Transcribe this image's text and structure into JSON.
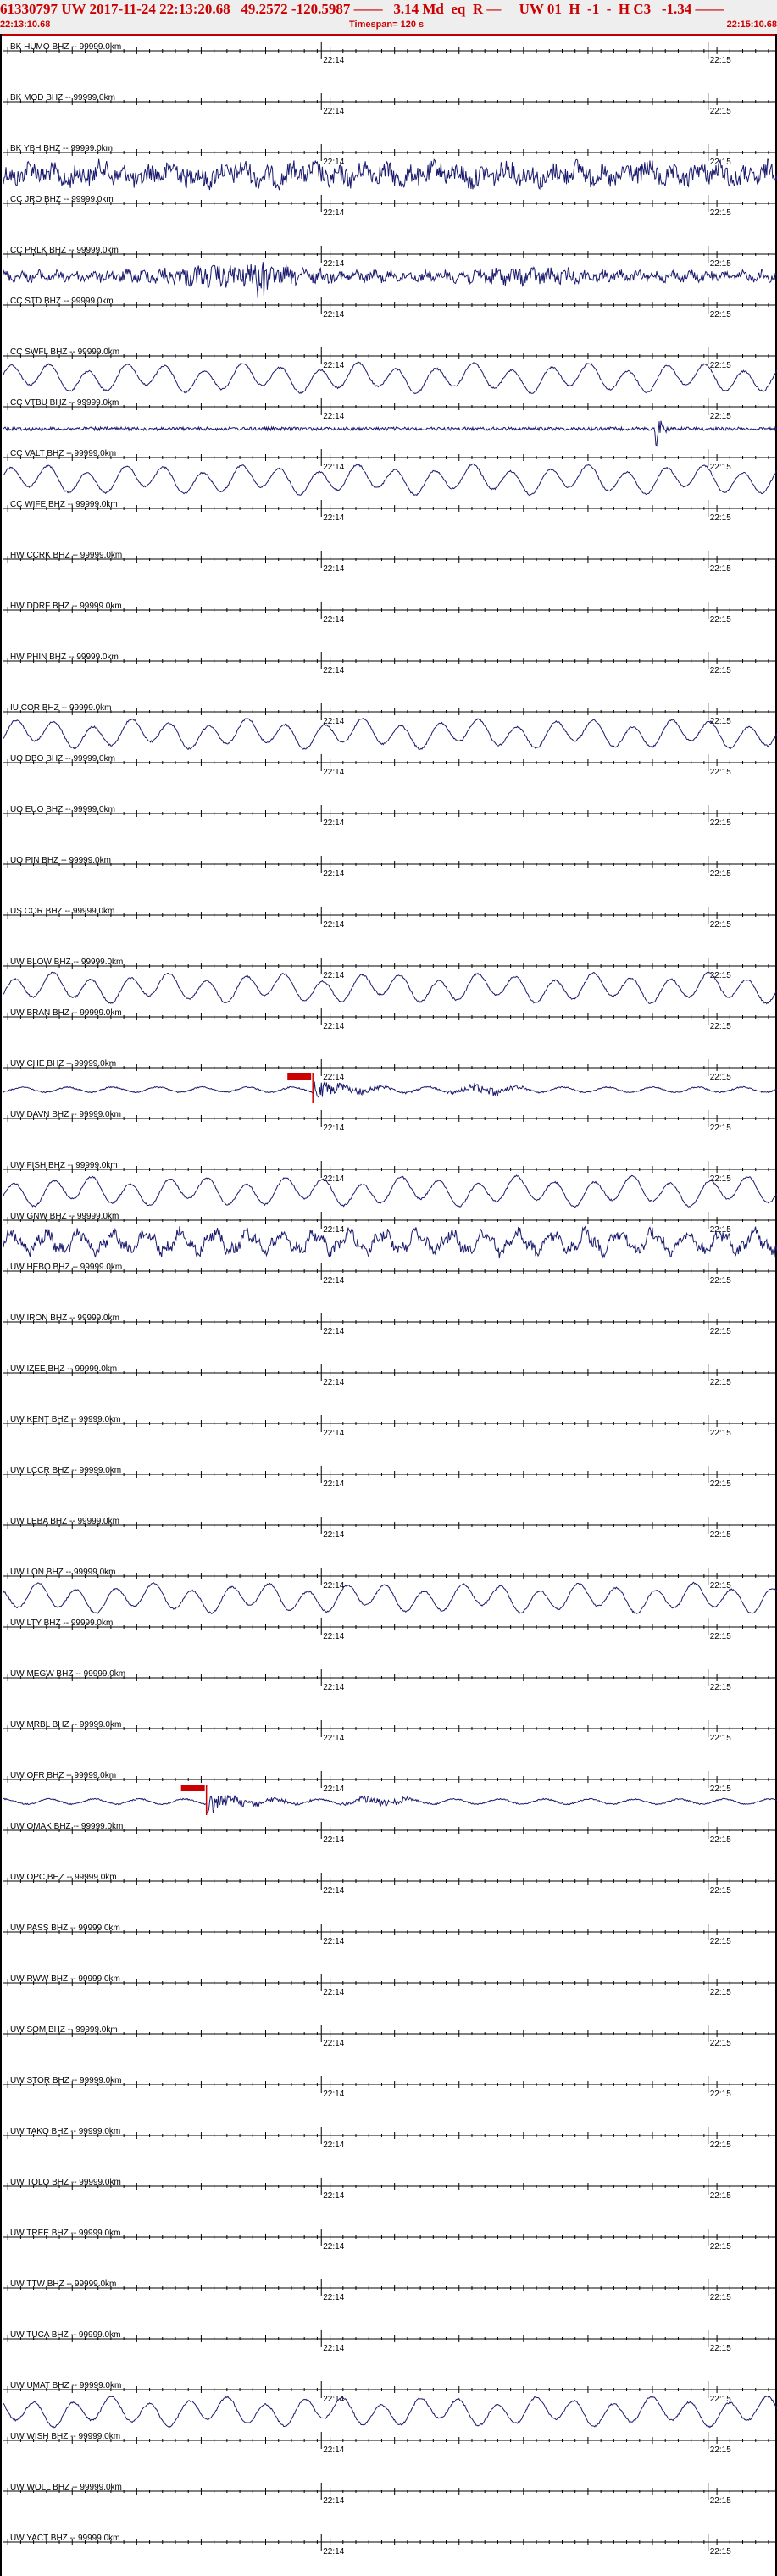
{
  "header": {
    "title": "61330797 UW 2017-11-24 22:13:20.68   49.2572 -120.5987 ——   3.14 Md  eq  R —     UW 01  H  -1  -  H C3   -1.34 ——",
    "start_time": "22:13:10.68",
    "end_time": "22:15:10.68",
    "timespan": "Timespan= 120 s"
  },
  "chart_data": {
    "type": "line",
    "title": "61330797 UW 2017-11-24 22:13:20.68",
    "x_axis": {
      "start": "22:13:10.68",
      "end": "22:15:10.68",
      "span_seconds": 120,
      "tick_labels": [
        "22:14",
        "22:15"
      ],
      "major_tick_seconds": [
        49.32,
        109.32
      ]
    },
    "trace_color": "#1a1a6e",
    "pick_color": "#cc0000",
    "channels": [
      {
        "label": "BK HUMO BHZ -- 99999.0km",
        "signal": "none"
      },
      {
        "label": "BK MOD BHZ -- 99999.0km",
        "signal": "none"
      },
      {
        "label": "BK YBH BHZ -- 99999.0km",
        "signal": "noise"
      },
      {
        "label": "CC JRO BHZ -- 99999.0km",
        "signal": "none"
      },
      {
        "label": "CC PRLK BHZ -- 99999.0km",
        "signal": "noise_burst"
      },
      {
        "label": "CC STD BHZ -- 99999.0km",
        "signal": "none"
      },
      {
        "label": "CC SWFL BHZ -- 99999.0km",
        "signal": "longperiod"
      },
      {
        "label": "CC VTBU BHZ -- 99999.0km",
        "signal": "flat_spike"
      },
      {
        "label": "CC VALT BHZ -- 99999.0km",
        "signal": "longperiod"
      },
      {
        "label": "CC WIFE BHZ -- 99999.0km",
        "signal": "none"
      },
      {
        "label": "HW CCRK BHZ -- 99999.0km",
        "signal": "none"
      },
      {
        "label": "HW DDRF BHZ -- 99999.0km",
        "signal": "none"
      },
      {
        "label": "HW PHIN BHZ -- 99999.0km",
        "signal": "none"
      },
      {
        "label": "IU COR BHZ -- 99999.0km",
        "signal": "longperiod"
      },
      {
        "label": "UO DBO BHZ -- 99999.0km",
        "signal": "none"
      },
      {
        "label": "UO EUO BHZ -- 99999.0km",
        "signal": "none"
      },
      {
        "label": "UO PIN BHZ -- 99999.0km",
        "signal": "none"
      },
      {
        "label": "US COR BHZ -- 99999.0km",
        "signal": "none"
      },
      {
        "label": "UW BLOW BHZ -- 99999.0km",
        "signal": "longperiod"
      },
      {
        "label": "UW BRAN BHZ -- 99999.0km",
        "signal": "none"
      },
      {
        "label": "UW CHE BHZ -- 99999.0km",
        "signal": "event",
        "pick_seconds": 48.0
      },
      {
        "label": "UW DAVN BHZ -- 99999.0km",
        "signal": "none"
      },
      {
        "label": "UW FISH BHZ -- 99999.0km",
        "signal": "longperiod"
      },
      {
        "label": "UW GNW BHZ -- 99999.0km",
        "signal": "longperiod_noise"
      },
      {
        "label": "UW HEBO BHZ -- 99999.0km",
        "signal": "none"
      },
      {
        "label": "UW IRON BHZ -- 99999.0km",
        "signal": "none"
      },
      {
        "label": "UW IZEE BHZ -- 99999.0km",
        "signal": "none"
      },
      {
        "label": "UW KENT BHZ -- 99999.0km",
        "signal": "none"
      },
      {
        "label": "UW LCCR BHZ -- 99999.0km",
        "signal": "none"
      },
      {
        "label": "UW LEBA BHZ -- 99999.0km",
        "signal": "none"
      },
      {
        "label": "UW LON BHZ -- 99999.0km",
        "signal": "longperiod"
      },
      {
        "label": "UW LTY BHZ -- 99999.0km",
        "signal": "none"
      },
      {
        "label": "UW MEGW BHZ -- 99999.0km",
        "signal": "none"
      },
      {
        "label": "UW MRBL BHZ -- 99999.0km",
        "signal": "none"
      },
      {
        "label": "UW OFR BHZ -- 99999.0km",
        "signal": "event",
        "pick_seconds": 31.5
      },
      {
        "label": "UW OMAK BHZ -- 99999.0km",
        "signal": "none"
      },
      {
        "label": "UW OPC BHZ -- 99999.0km",
        "signal": "none"
      },
      {
        "label": "UW PASS BHZ -- 99999.0km",
        "signal": "none"
      },
      {
        "label": "UW RWW BHZ -- 99999.0km",
        "signal": "none"
      },
      {
        "label": "UW SQM BHZ -- 99999.0km",
        "signal": "none"
      },
      {
        "label": "UW STOR BHZ -- 99999.0km",
        "signal": "none"
      },
      {
        "label": "UW TAKO BHZ -- 99999.0km",
        "signal": "none"
      },
      {
        "label": "UW TOLO BHZ -- 99999.0km",
        "signal": "none"
      },
      {
        "label": "UW TREE BHZ -- 99999.0km",
        "signal": "none"
      },
      {
        "label": "UW TTW BHZ -- 99999.0km",
        "signal": "none"
      },
      {
        "label": "UW TUCA BHZ -- 99999.0km",
        "signal": "none"
      },
      {
        "label": "UW UMAT BHZ -- 99999.0km",
        "signal": "longperiod"
      },
      {
        "label": "UW WISH BHZ -- 99999.0km",
        "signal": "none"
      },
      {
        "label": "UW WOLL BHZ -- 99999.0km",
        "signal": "none"
      },
      {
        "label": "UW YACT BHZ -- 99999.0km",
        "signal": "none"
      }
    ]
  }
}
